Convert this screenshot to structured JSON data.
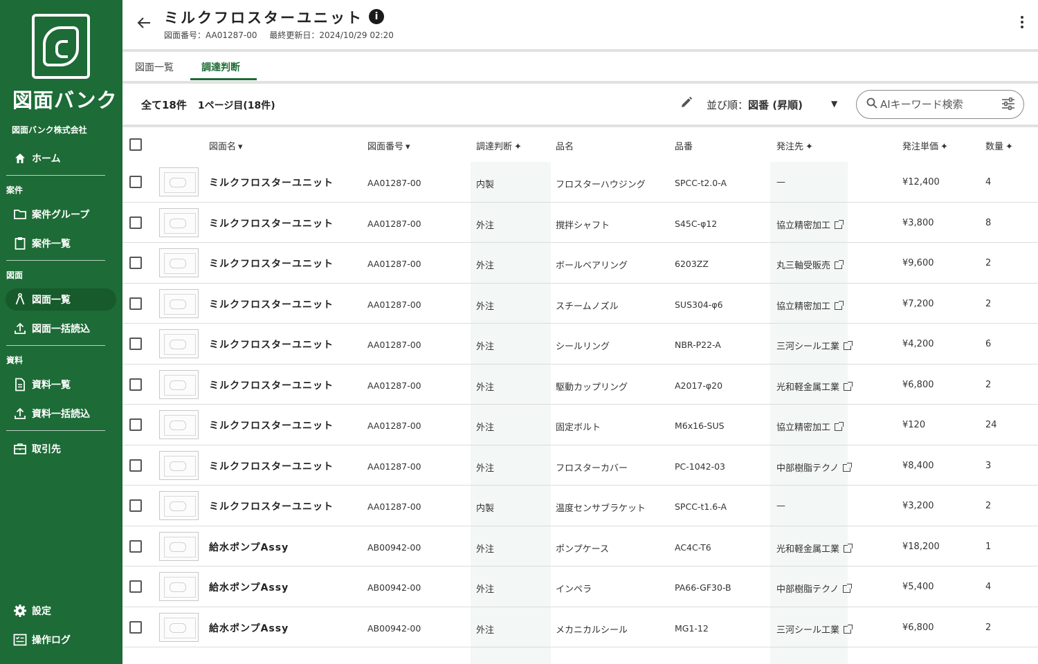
{
  "sidebar": {
    "logo_text": "図面バンク",
    "company": "図面バンク株式会社",
    "home": "ホーム",
    "section_cases": "案件",
    "case_groups": "案件グループ",
    "case_list": "案件一覧",
    "section_drawings": "図面",
    "drawing_list": "図面一覧",
    "drawing_bulk_import": "図面一括読込",
    "section_materials": "資料",
    "material_list": "資料一覧",
    "material_bulk_import": "資料一括読込",
    "suppliers": "取引先",
    "settings": "設定",
    "operation_log": "操作ログ"
  },
  "header": {
    "title": "ミルクフロスターユニット",
    "drawing_number": "図面番号：AA01287-00",
    "last_updated": "最終更新日：2024/10/29 02:20"
  },
  "tabs": [
    "図面一覧",
    "調達判断"
  ],
  "toolbar": {
    "total": "全て18件",
    "page": "1ページ目(18件)",
    "sort_prefix": "並び順：",
    "sort_value": "図番 (昇順)",
    "search_placeholder": "AIキーワード検索"
  },
  "table": {
    "columns": [
      "図面名",
      "図面番号",
      "調達判断",
      "品名",
      "品番",
      "発注先",
      "発注単価",
      "数量"
    ],
    "rows": [
      {
        "name": "ミルクフロスターユニット",
        "number": "AA01287-00",
        "decision": "内製",
        "item": "フロスターハウジング",
        "part": "SPCC-t2.0-A",
        "supplier": "—",
        "supplier_link": false,
        "price": "¥12,400",
        "qty": "4"
      },
      {
        "name": "ミルクフロスターユニット",
        "number": "AA01287-00",
        "decision": "外注",
        "item": "撹拌シャフト",
        "part": "S45C-φ12",
        "supplier": "協立精密加工",
        "supplier_link": true,
        "price": "¥3,800",
        "qty": "8"
      },
      {
        "name": "ミルクフロスターユニット",
        "number": "AA01287-00",
        "decision": "外注",
        "item": "ボールベアリング",
        "part": "6203ZZ",
        "supplier": "丸三軸受販売",
        "supplier_link": true,
        "price": "¥9,600",
        "qty": "2"
      },
      {
        "name": "ミルクフロスターユニット",
        "number": "AA01287-00",
        "decision": "外注",
        "item": "スチームノズル",
        "part": "SUS304-φ6",
        "supplier": "協立精密加工",
        "supplier_link": true,
        "price": "¥7,200",
        "qty": "2"
      },
      {
        "name": "ミルクフロスターユニット",
        "number": "AA01287-00",
        "decision": "外注",
        "item": "シールリング",
        "part": "NBR-P22-A",
        "supplier": "三河シール工業",
        "supplier_link": true,
        "price": "¥4,200",
        "qty": "6"
      },
      {
        "name": "ミルクフロスターユニット",
        "number": "AA01287-00",
        "decision": "外注",
        "item": "駆動カップリング",
        "part": "A2017-φ20",
        "supplier": "光和軽金属工業",
        "supplier_link": true,
        "price": "¥6,800",
        "qty": "2"
      },
      {
        "name": "ミルクフロスターユニット",
        "number": "AA01287-00",
        "decision": "外注",
        "item": "固定ボルト",
        "part": "M6x16-SUS",
        "supplier": "協立精密加工",
        "supplier_link": true,
        "price": "¥120",
        "qty": "24"
      },
      {
        "name": "ミルクフロスターユニット",
        "number": "AA01287-00",
        "decision": "外注",
        "item": "フロスターカバー",
        "part": "PC-1042-03",
        "supplier": "中部樹脂テクノ",
        "supplier_link": true,
        "price": "¥8,400",
        "qty": "3"
      },
      {
        "name": "ミルクフロスターユニット",
        "number": "AA01287-00",
        "decision": "内製",
        "item": "温度センサブラケット",
        "part": "SPCC-t1.6-A",
        "supplier": "—",
        "supplier_link": false,
        "price": "¥3,200",
        "qty": "2"
      },
      {
        "name": "給水ポンプAssy",
        "number": "AB00942-00",
        "decision": "外注",
        "item": "ポンプケース",
        "part": "AC4C-T6",
        "supplier": "光和軽金属工業",
        "supplier_link": true,
        "price": "¥18,200",
        "qty": "1"
      },
      {
        "name": "給水ポンプAssy",
        "number": "AB00942-00",
        "decision": "外注",
        "item": "インペラ",
        "part": "PA66-GF30-B",
        "supplier": "中部樹脂テクノ",
        "supplier_link": true,
        "price": "¥5,400",
        "qty": "4"
      },
      {
        "name": "給水ポンプAssy",
        "number": "AB00942-00",
        "decision": "外注",
        "item": "メカニカルシール",
        "part": "MG1-12",
        "supplier": "三河シール工業",
        "supplier_link": true,
        "price": "¥6,800",
        "qty": "2"
      }
    ]
  }
}
